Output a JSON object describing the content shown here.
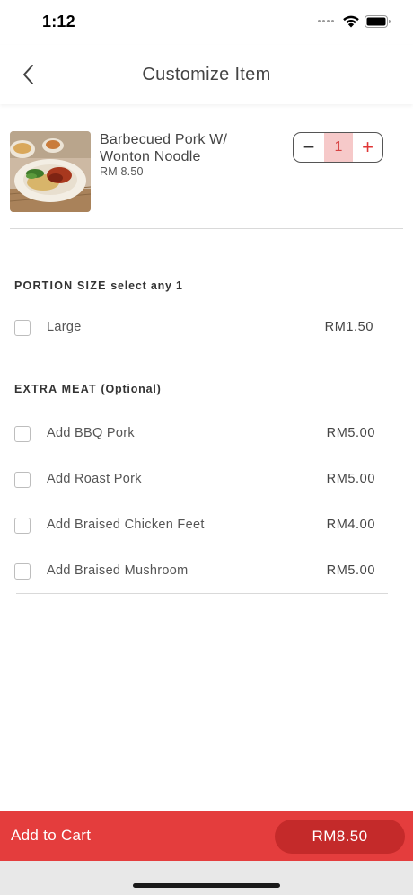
{
  "status_bar": {
    "time": "1:12",
    "icons": [
      "signal-dots-icon",
      "wifi-icon",
      "battery-icon"
    ]
  },
  "nav": {
    "title": "Customize Item",
    "back_icon": "chevron-left-icon"
  },
  "item": {
    "name": "Barbecued Pork W/ Wonton Noodle",
    "price": "RM 8.50",
    "image": "food-photo"
  },
  "quantity": {
    "minus": "−",
    "value": "1",
    "plus": "+"
  },
  "portion_section": {
    "title": "PORTION SIZE",
    "subtitle": "select any 1",
    "options": [
      {
        "label": "Large",
        "price": "RM1.50",
        "checked": false
      }
    ]
  },
  "extra_meat_section": {
    "title": "EXTRA MEAT",
    "subtitle": "(Optional)",
    "options": [
      {
        "label": "Add BBQ Pork",
        "price": "RM5.00",
        "checked": false
      },
      {
        "label": "Add Roast Pork",
        "price": "RM5.00",
        "checked": false
      },
      {
        "label": "Add Braised Chicken Feet",
        "price": "RM4.00",
        "checked": false
      },
      {
        "label": "Add Braised Mushroom",
        "price": "RM5.00",
        "checked": false
      }
    ]
  },
  "cart": {
    "label": "Add to Cart",
    "total": "RM8.50"
  },
  "colors": {
    "accent": "#e43d3d",
    "accent_dark": "#c42a2a",
    "qty_bg": "#f6c9c9"
  }
}
